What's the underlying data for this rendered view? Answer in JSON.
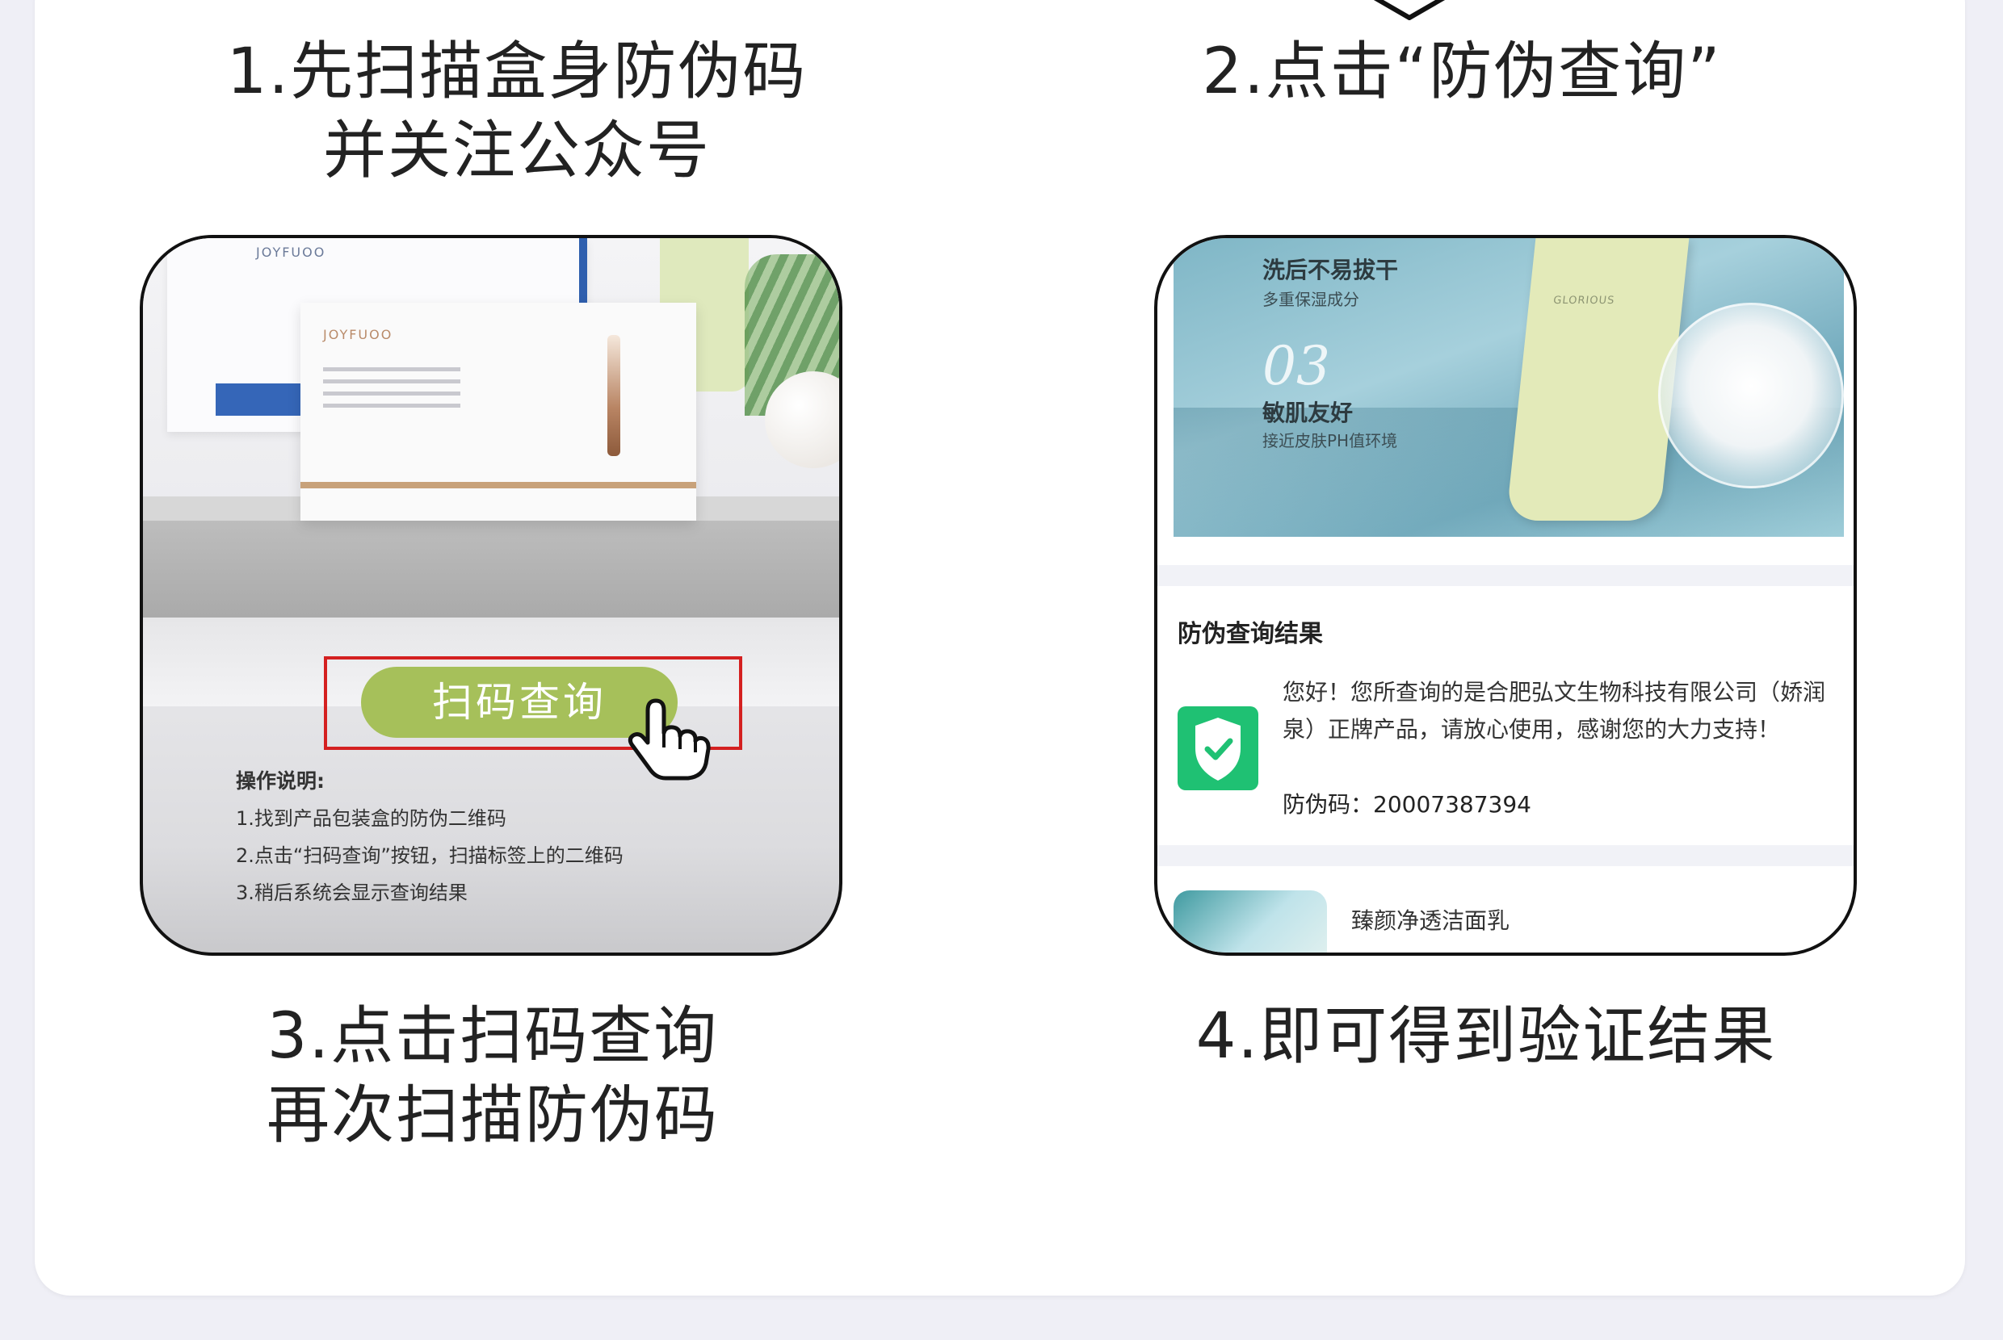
{
  "captions": {
    "step1_line1": "1.先扫描盒身防伪码",
    "step1_line2": "并关注公众号",
    "step2": "2.点击“防伪查询”",
    "step3_line1": "3.点击扫码查询",
    "step3_line2": "再次扫描防伪码",
    "step4": "4.即可得到验证结果"
  },
  "panel3": {
    "scan_button_label": "扫码查询",
    "instructions_title": "操作说明:",
    "instructions": [
      "1.找到产品包装盒的防伪二维码",
      "2.点击“扫码查询”按钮，扫描标签上的二维码",
      "3.稍后系统会显示查询结果"
    ],
    "box_brand": "JOYFUOO",
    "box_text": "JOYFUOO",
    "accent_button": "#a6c05a",
    "frame_color": "#d42020"
  },
  "panel4": {
    "hero_title": "洗后不易拔干",
    "hero_subtitle": "多重保湿成分",
    "hero_number": "03",
    "hero_title2": "敏肌友好",
    "hero_subtitle2": "接近皮肤PH值环境",
    "tube_label": "GLORIOUS",
    "result_title": "防伪查询结果",
    "result_text": "您好！您所查询的是合肥弘文生物科技有限公司（娇润泉）正牌产品，请放心使用，感谢您的大力支持！",
    "code_label": "防伪码：",
    "code_value": "20007387394",
    "product_name": "臻颜净透洁面乳",
    "shield_color": "#1fc173"
  }
}
